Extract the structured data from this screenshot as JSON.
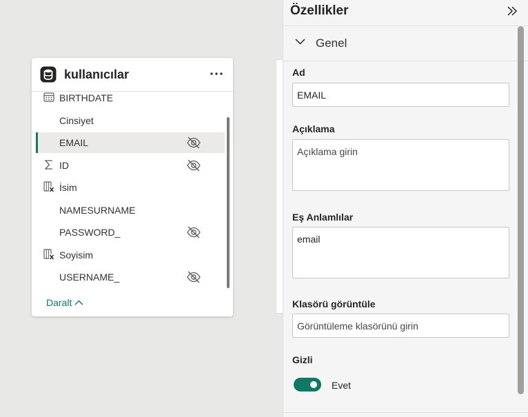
{
  "table_card": {
    "title": "kullanıcılar",
    "fields": [
      {
        "label": "BIRTHDATE",
        "icon": "calendar-icon",
        "hidden": false,
        "selected": false
      },
      {
        "label": "Cinsiyet",
        "icon": "",
        "hidden": false,
        "selected": false
      },
      {
        "label": "EMAIL",
        "icon": "",
        "hidden": true,
        "selected": true
      },
      {
        "label": "ID",
        "icon": "sigma-icon",
        "hidden": true,
        "selected": false
      },
      {
        "label": "İsim",
        "icon": "calculated-column-icon",
        "hidden": false,
        "selected": false
      },
      {
        "label": "NAMESURNAME",
        "icon": "",
        "hidden": false,
        "selected": false
      },
      {
        "label": "PASSWORD_",
        "icon": "",
        "hidden": true,
        "selected": false
      },
      {
        "label": "Soyisim",
        "icon": "calculated-column-icon",
        "hidden": false,
        "selected": false
      },
      {
        "label": "USERNAME_",
        "icon": "",
        "hidden": true,
        "selected": false
      }
    ],
    "collapse_label": "Daralt"
  },
  "properties": {
    "title": "Özellikler",
    "section": "Genel",
    "name_label": "Ad",
    "name_value": "EMAIL",
    "description_label": "Açıklama",
    "description_placeholder": "Açıklama girin",
    "synonyms_label": "Eş Anlamlılar",
    "synonyms_value": "email",
    "display_folder_label": "Klasörü görüntüle",
    "display_folder_placeholder": "Görüntüleme klasörünü girin",
    "hidden_label": "Gizli",
    "hidden_state": "Evet",
    "hidden_on": true
  },
  "colors": {
    "accent": "#117865",
    "canvas": "#e8e8e7",
    "pane": "#f5f5f5"
  }
}
